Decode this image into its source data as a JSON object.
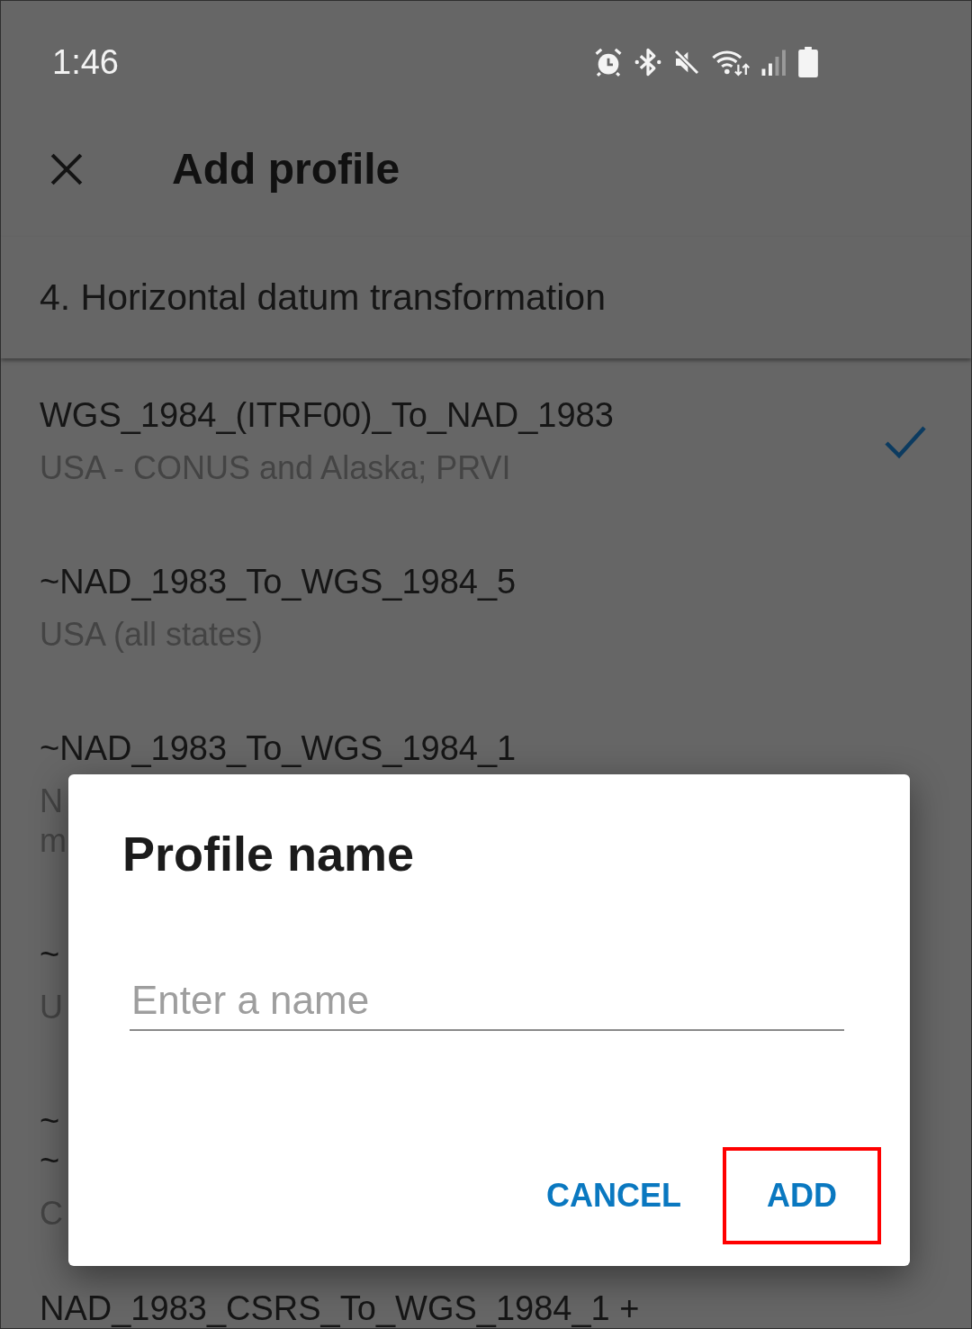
{
  "status_bar": {
    "time": "1:46"
  },
  "toolbar": {
    "title": "Add profile"
  },
  "section_header": "4. Horizontal datum transformation",
  "transformations": [
    {
      "title_lines": [
        "WGS_1984_(ITRF00)_To_NAD_1983"
      ],
      "subtitle_lines": [
        "USA - CONUS and Alaska; PRVI"
      ],
      "selected": true
    },
    {
      "title_lines": [
        "~NAD_1983_To_WGS_1984_5"
      ],
      "subtitle_lines": [
        "USA (all states)"
      ],
      "selected": false
    },
    {
      "title_lines": [
        "~NAD_1983_To_WGS_1984_1"
      ],
      "subtitle_lines": [
        "N",
        "m"
      ],
      "selected": false
    },
    {
      "title_lines": [
        "~"
      ],
      "subtitle_lines": [
        "U"
      ],
      "selected": false
    },
    {
      "title_lines": [
        "~",
        "~"
      ],
      "subtitle_lines": [
        "C"
      ],
      "selected": false
    },
    {
      "title_lines": [
        "NAD_1983_CSRS_To_WGS_1984_1 +"
      ],
      "selected": false
    }
  ],
  "dialog": {
    "title": "Profile name",
    "name_field": {
      "placeholder": "Enter a name"
    },
    "buttons": [
      {
        "label": "CANCEL",
        "highlighted": false
      },
      {
        "label": "ADD",
        "highlighted": true
      }
    ]
  }
}
